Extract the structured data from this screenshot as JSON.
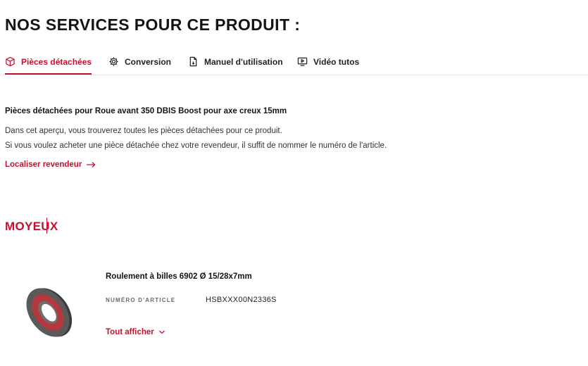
{
  "header": {
    "title": "NOS SERVICES POUR CE PRODUIT :"
  },
  "tabs": [
    {
      "label": "Pièces détachées",
      "icon": "box-icon",
      "active": true
    },
    {
      "label": "Conversion",
      "icon": "gear-icon",
      "active": false
    },
    {
      "label": "Manuel d'utilisation",
      "icon": "document-icon",
      "active": false
    },
    {
      "label": "Vidéo tutos",
      "icon": "video-icon",
      "active": false
    }
  ],
  "content": {
    "subtitle": "Pièces détachées pour Roue avant 350 DBIS Boost pour axe creux 15mm",
    "description_line1": "Dans cet aperçu, vous trouverez toutes les pièces détachées pour ce produit.",
    "description_line2": "Si vous voulez acheter une pièce détachée chez votre revendeur, il suffit de nommer le numéro de l'article.",
    "dealer_link": "Localiser revendeur"
  },
  "section": {
    "title": "MOYEUX"
  },
  "part": {
    "name": "Roulement à billes 6902 Ø 15/28x7mm",
    "article_label": "NUMÉRO D'ARTICLE",
    "article_number": "HSBXXX00N2336S",
    "show_all": "Tout afficher"
  },
  "colors": {
    "accent": "#c8102e",
    "text": "#141414",
    "muted": "#6a6a6a",
    "divider": "#e4e4e4"
  }
}
